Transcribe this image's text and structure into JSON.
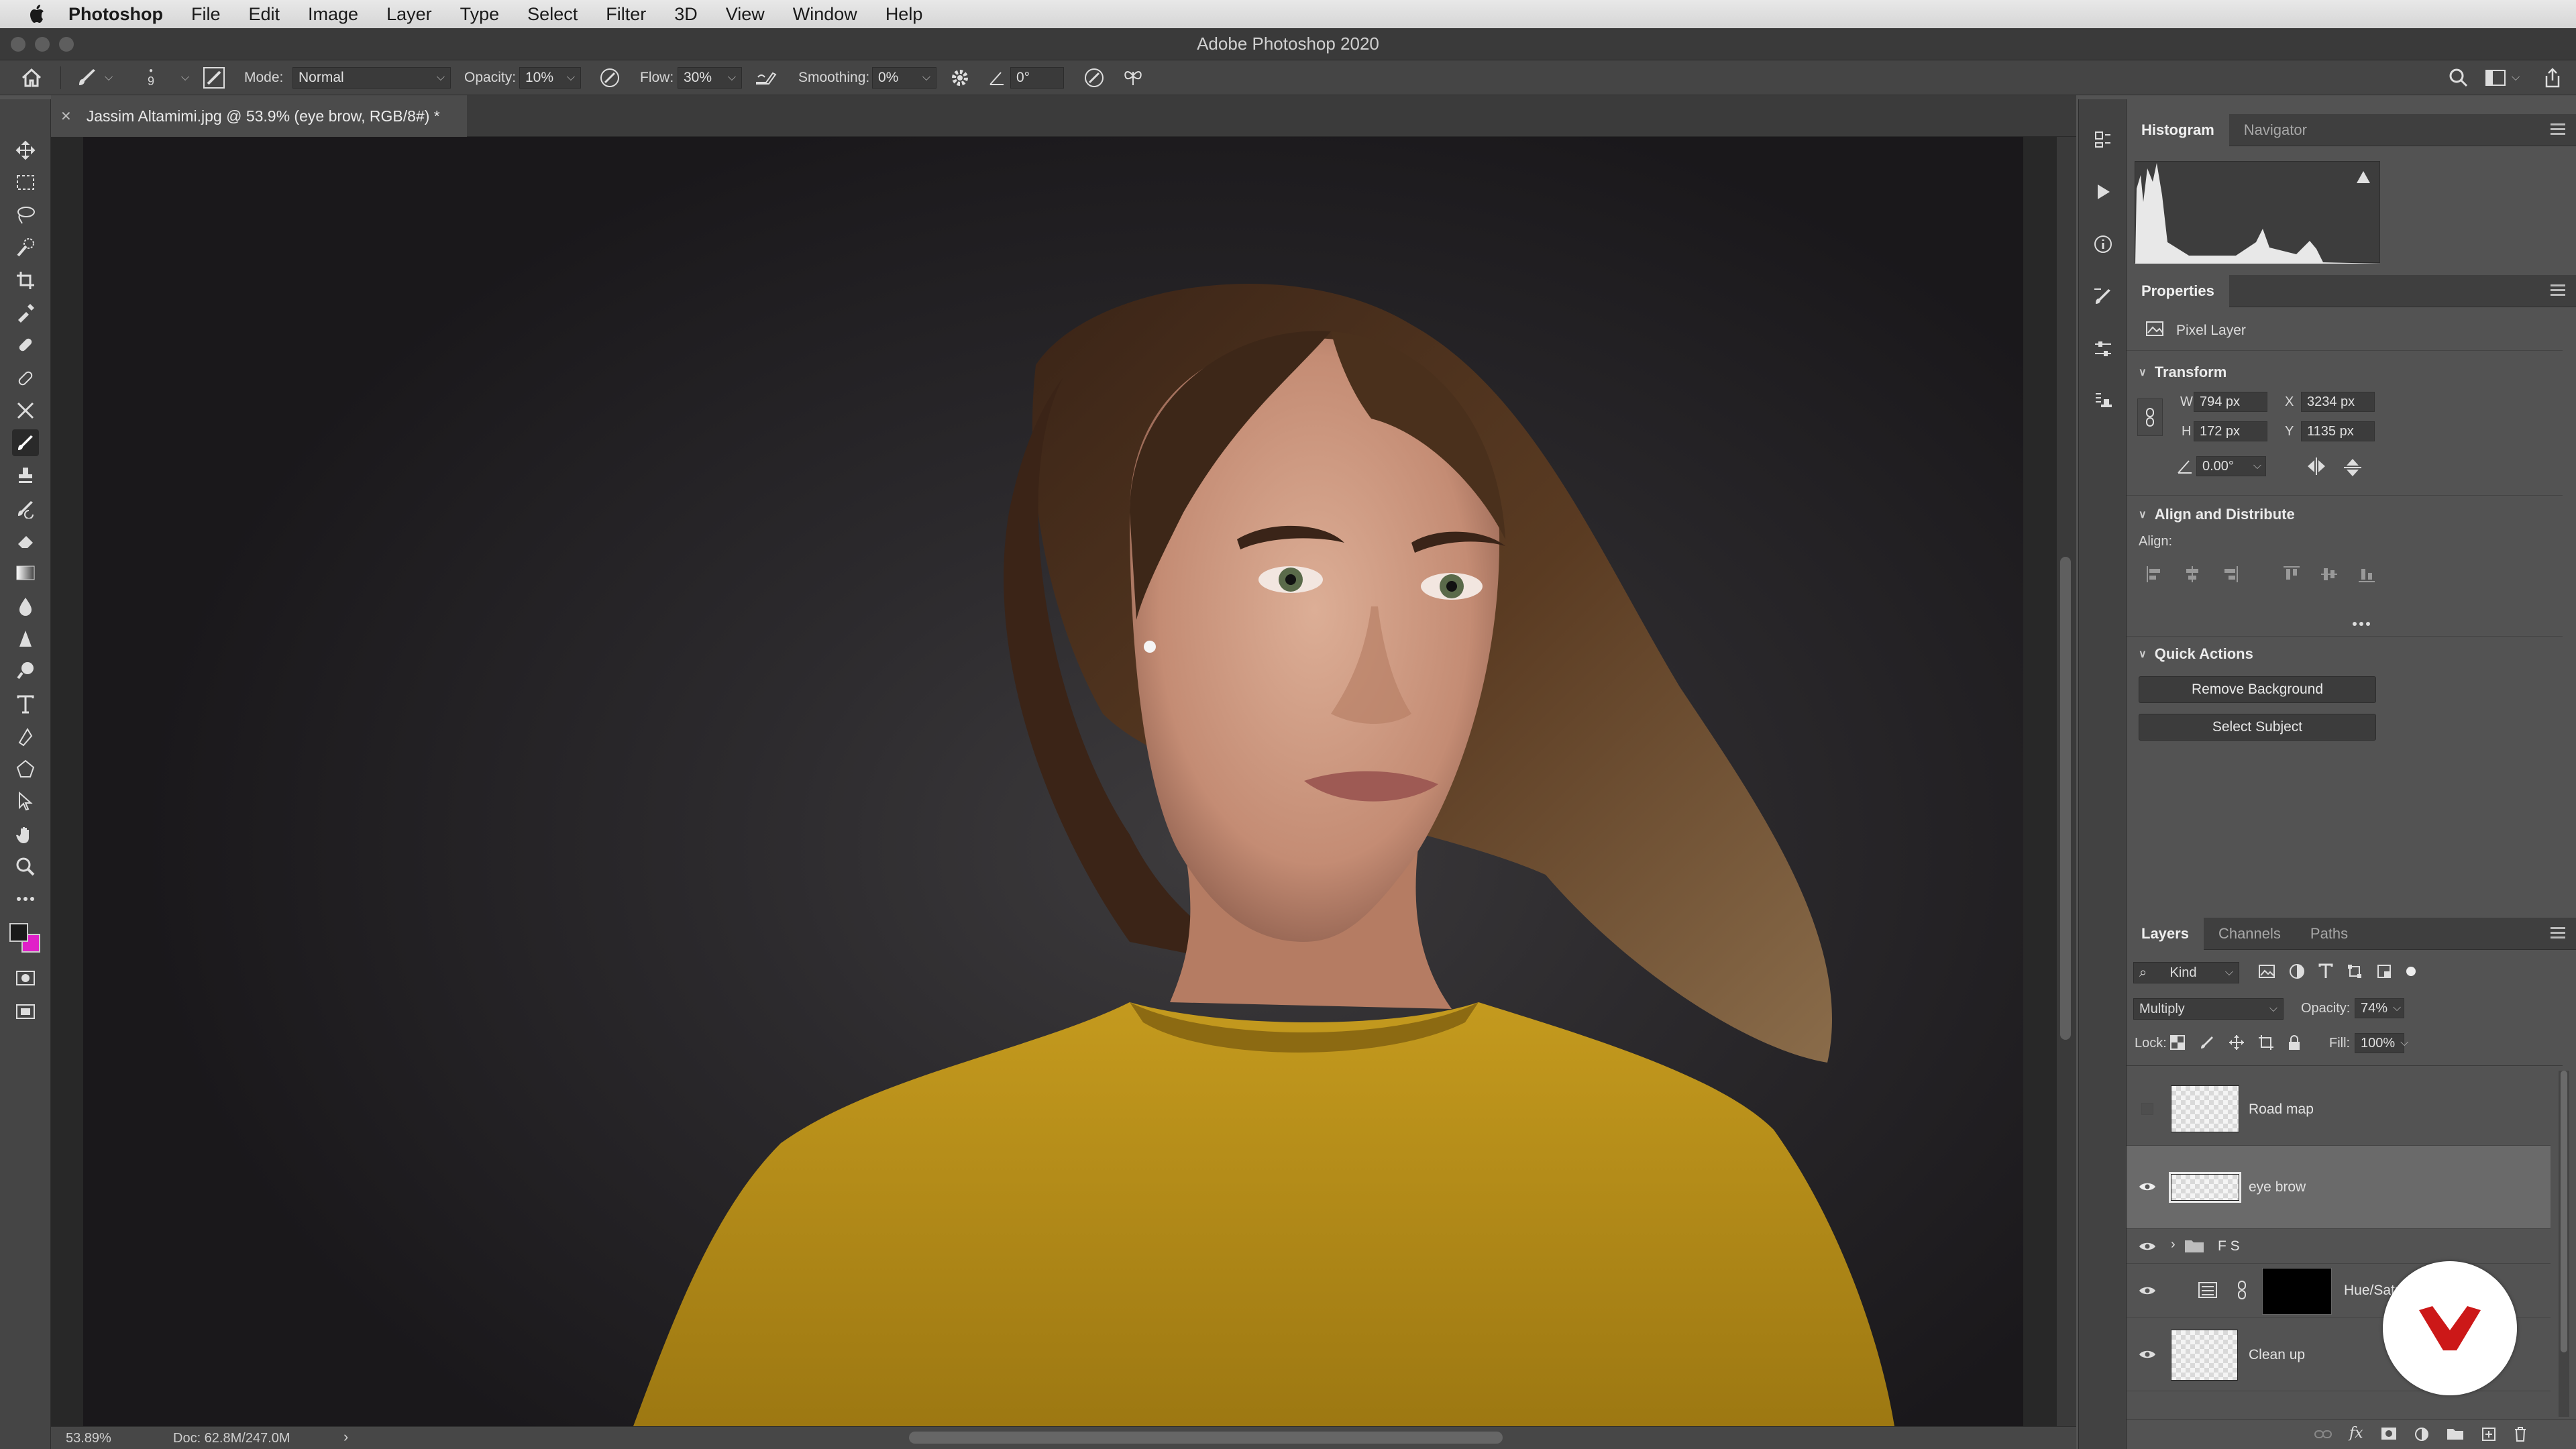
{
  "menubar": {
    "app_name": "Photoshop",
    "items": [
      "File",
      "Edit",
      "Image",
      "Layer",
      "Type",
      "Select",
      "Filter",
      "3D",
      "View",
      "Window",
      "Help"
    ]
  },
  "window_title": "Adobe Photoshop 2020",
  "options": {
    "brush_size": "9",
    "mode_label": "Mode:",
    "mode_value": "Normal",
    "opacity_label": "Opacity:",
    "opacity_value": "10%",
    "flow_label": "Flow:",
    "flow_value": "30%",
    "smoothing_label": "Smoothing:",
    "smoothing_value": "0%",
    "angle_value": "0°"
  },
  "document": {
    "tab_title": "Jassim Altamimi.jpg @ 53.9% (eye brow, RGB/8#) *",
    "zoom": "53.89%",
    "doc_size": "Doc: 62.8M/247.0M"
  },
  "panels": {
    "histogram_tabs": [
      "Histogram",
      "Navigator"
    ],
    "properties_title": "Properties",
    "layer_type": "Pixel Layer",
    "transform": {
      "title": "Transform",
      "w_label": "W",
      "w": "794 px",
      "x_label": "X",
      "x": "3234 px",
      "h_label": "H",
      "h": "172 px",
      "y_label": "Y",
      "y": "1135 px",
      "angle": "0.00°"
    },
    "align": {
      "title": "Align and Distribute",
      "label": "Align:"
    },
    "quick_actions": {
      "title": "Quick Actions",
      "remove_bg": "Remove Background",
      "select_subject": "Select Subject"
    },
    "layer_tabs": [
      "Layers",
      "Channels",
      "Paths"
    ],
    "filter_kind": "Kind",
    "blend_mode": "Multiply",
    "opacity_label": "Opacity:",
    "opacity": "74%",
    "lock_label": "Lock:",
    "fill_label": "Fill:",
    "fill": "100%",
    "layers": [
      {
        "name": "Road map",
        "visible": false
      },
      {
        "name": "eye brow",
        "visible": true,
        "selected": true
      },
      {
        "name": "F S",
        "visible": true,
        "group": true
      },
      {
        "name": "Hue/Saturation",
        "visible": true
      },
      {
        "name": "Clean up",
        "visible": true
      }
    ]
  },
  "colors": {
    "foreground": "#1a1a1a",
    "background": "#e020c8",
    "sweater": "#b8901a",
    "accent_logo": "#cc1818"
  }
}
